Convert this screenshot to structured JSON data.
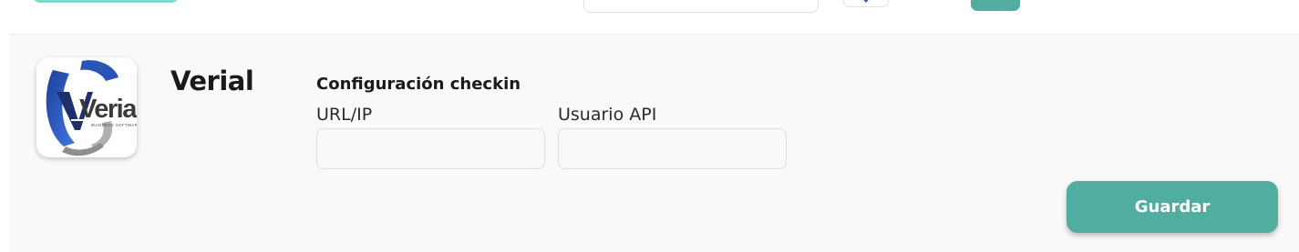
{
  "integration": {
    "name": "Verial",
    "logo_alt": "Verial Business Software",
    "logo_text": "Verial"
  },
  "form": {
    "section_title": "Configuración checkin",
    "fields": [
      {
        "label": "URL/IP",
        "value": "",
        "placeholder": ""
      },
      {
        "label": "Usuario API",
        "value": "",
        "placeholder": ""
      }
    ],
    "save_label": "Guardar"
  },
  "colors": {
    "accent": "#52ada1",
    "accent_light": "#7fd8c8",
    "panel_bg": "#f9f9f9",
    "logo_blue": "#2f5fc4"
  },
  "icons": {
    "logo": "verial-logo",
    "header_logo": "verial-logo-icon"
  }
}
